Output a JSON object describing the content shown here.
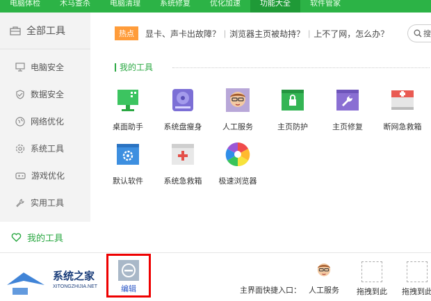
{
  "topnav": {
    "tabs": [
      {
        "label": "电脑体检",
        "active": false
      },
      {
        "label": "木马查杀",
        "active": false
      },
      {
        "label": "电脑清理",
        "active": false
      },
      {
        "label": "系统修复",
        "active": false
      },
      {
        "label": "优化加速",
        "active": false
      },
      {
        "label": "功能大全",
        "active": true
      },
      {
        "label": "软件管家",
        "active": false
      }
    ]
  },
  "sidebar": {
    "header": "全部工具",
    "items": [
      {
        "label": "电脑安全",
        "icon": "monitor-icon"
      },
      {
        "label": "数据安全",
        "icon": "shield-icon"
      },
      {
        "label": "网络优化",
        "icon": "globe-icon"
      },
      {
        "label": "系统工具",
        "icon": "gear-icon"
      },
      {
        "label": "游戏优化",
        "icon": "gamepad-icon"
      },
      {
        "label": "实用工具",
        "icon": "wrench-icon"
      }
    ],
    "active": "我的工具"
  },
  "hot": {
    "badge": "热点",
    "links": [
      "显卡、声卡出故障？",
      "浏览器主页被劫持？",
      "上不了网，怎么办？"
    ],
    "search_placeholder": "搜"
  },
  "section": {
    "title": "我的工具"
  },
  "tools": [
    {
      "label": "桌面助手",
      "icon": "desktop-assistant-icon"
    },
    {
      "label": "系统盘瘦身",
      "icon": "disk-slim-icon"
    },
    {
      "label": "人工服务",
      "icon": "human-service-icon"
    },
    {
      "label": "主页防护",
      "icon": "homepage-lock-icon"
    },
    {
      "label": "主页修复",
      "icon": "homepage-repair-icon"
    },
    {
      "label": "断网急救箱",
      "icon": "network-firstaid-icon"
    },
    {
      "label": "默认软件",
      "icon": "default-software-icon"
    },
    {
      "label": "系统急救箱",
      "icon": "system-firstaid-icon"
    },
    {
      "label": "极速浏览器",
      "icon": "browser-icon"
    }
  ],
  "bottom": {
    "edit_label": "编辑",
    "quick_label": "主界面快捷入口：",
    "quick_items": [
      "人工服务",
      "拖拽到此",
      "拖拽到此"
    ]
  },
  "watermark": {
    "name": "系统之家",
    "pinyin": "XITONGZHIJIA.NET"
  },
  "colors": {
    "brand_green": "#2cb346",
    "accent_orange": "#ff9c3a",
    "highlight_red": "#e00000"
  }
}
